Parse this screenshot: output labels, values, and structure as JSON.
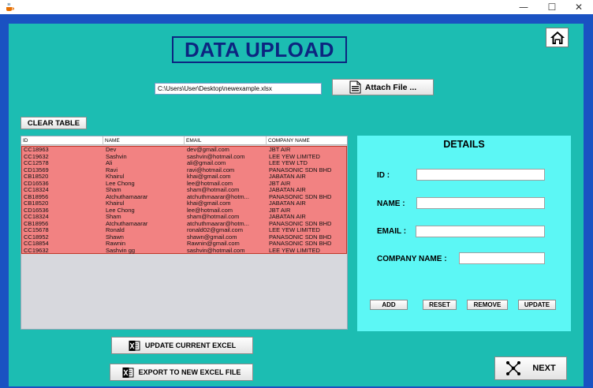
{
  "window": {
    "minimize_glyph": "—",
    "maximize_glyph": "☐",
    "close_glyph": "✕"
  },
  "header": {
    "title": "DATA UPLOAD"
  },
  "file": {
    "path": "C:\\Users\\User\\Desktop\\newexample.xlsx",
    "attach_label": "Attach File ..."
  },
  "toolbar": {
    "clear_label": "CLEAR TABLE"
  },
  "table": {
    "columns": [
      "ID",
      "NAME",
      "EMAIL",
      "COMPANY NAME"
    ],
    "rows": [
      [
        "CC18963",
        "Dev",
        "dev@gmail.com",
        "JBT AIR"
      ],
      [
        "CC19632",
        "Sashvin",
        "sashvin@hotmail.com",
        "LEE YEW LIMITED"
      ],
      [
        "CC12578",
        "Ali",
        "ali@gmail.com",
        "LEE YEW LTD"
      ],
      [
        "CD13569",
        "Ravi",
        "ravi@hotmail.com",
        "PANASONIC SDN BHD"
      ],
      [
        "CB18520",
        "Khairul",
        "khai@gmail.com",
        "JABATAN AIR"
      ],
      [
        "CD16536",
        "Lee Chong",
        "lee@hotmail.com",
        "JBT AIR"
      ],
      [
        "CC18324",
        "Sham",
        "sham@hotmail.com",
        "JABATAN AIR"
      ],
      [
        "CB18956",
        "Atchuthamaarar",
        "atchuthmaarar@hotm...",
        "PANASONIC SDN BHD"
      ],
      [
        "CB18520",
        "Khairul",
        "khai@gmail.com",
        "JABATAN AIR"
      ],
      [
        "CD16536",
        "Lee Chong",
        "lee@hotmail.com",
        "JBT AIR"
      ],
      [
        "CC18324",
        "Sham",
        "sham@hotmail.com",
        "JABATAN AIR"
      ],
      [
        "CB18956",
        "Atchuthamaarar",
        "atchuthmaarar@hotm...",
        "PANASONIC SDN BHD"
      ],
      [
        "CC15678",
        "Ronald",
        "ronald02@gmail.com",
        "LEE YEW LIMITED"
      ],
      [
        "CC18952",
        "Shawn",
        "shawn@gmail.com",
        "PANASONIC SDN BHD"
      ],
      [
        "CC18854",
        "Rawnin",
        "Rawnin@gmail.com",
        "PANASONIC SDN BHD"
      ],
      [
        "CC19632",
        "Sashvin gg",
        "sashvin@hotmail.com",
        "LEE YEW LIMITED"
      ]
    ]
  },
  "details": {
    "title": "DETAILS",
    "id_label": "ID :",
    "name_label": "NAME :",
    "email_label": "EMAIL :",
    "company_label": "COMPANY NAME :",
    "id_value": "",
    "name_value": "",
    "email_value": "",
    "company_value": "",
    "add_label": "ADD",
    "reset_label": "RESET",
    "remove_label": "REMOVE",
    "update_label": "UPDATE"
  },
  "actions": {
    "update_excel_label": "UPDATE  CURRENT EXCEL",
    "export_label": "EXPORT TO NEW EXCEL FILE",
    "next_label": "NEXT"
  },
  "colors": {
    "frame": "#1a52c2",
    "panel": "#1cbdb2",
    "title": "#0c2580",
    "details_bg": "#5cf7f5",
    "rows_bg": "#f28282"
  },
  "icons": {
    "app": "java-cup-icon",
    "home": "home-icon",
    "attach": "document-icon",
    "excel": "excel-icon",
    "next": "network-icon"
  }
}
